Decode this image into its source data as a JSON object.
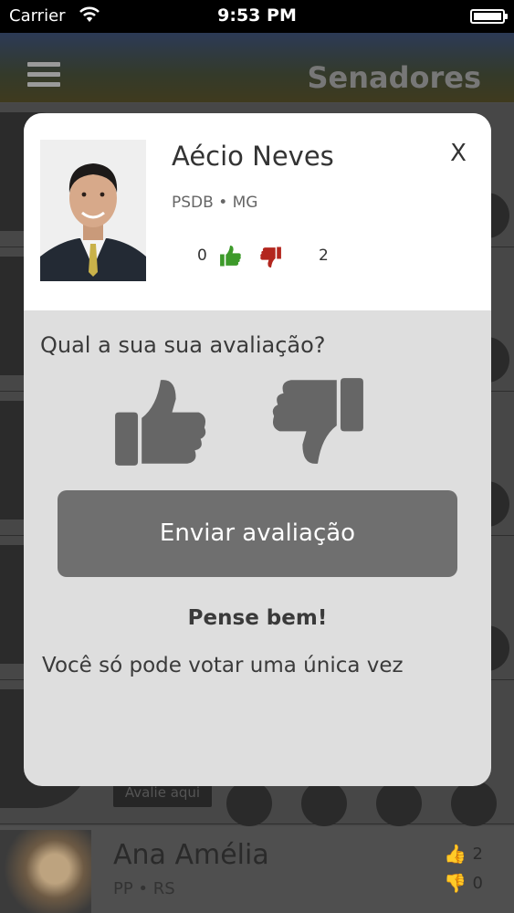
{
  "status_bar": {
    "carrier": "Carrier",
    "time": "9:53 PM"
  },
  "background": {
    "nav_title": "Senadores",
    "avalie_label": "Avalie aqui",
    "bottom_row": {
      "name": "Ana Amélia",
      "party": "PP • RS",
      "up_count": "2",
      "down_count": "0"
    }
  },
  "modal": {
    "name": "Aécio Neves",
    "party": "PSDB • MG",
    "close_label": "X",
    "up_votes": "0",
    "down_votes": "2",
    "question": "Qual a sua sua avaliação?",
    "submit_label": "Enviar avaliação",
    "warning_title": "Pense bem!",
    "warning_text": "Você só pode votar uma única vez"
  },
  "colors": {
    "thumb_up": "#3d9a2a",
    "thumb_down": "#b3261e",
    "thumb_choice": "#666666",
    "submit_bg": "#6f6f6f"
  },
  "icons": [
    "wifi-icon",
    "battery-icon",
    "hamburger-icon",
    "thumbs-up-icon",
    "thumbs-down-icon",
    "close-icon"
  ]
}
